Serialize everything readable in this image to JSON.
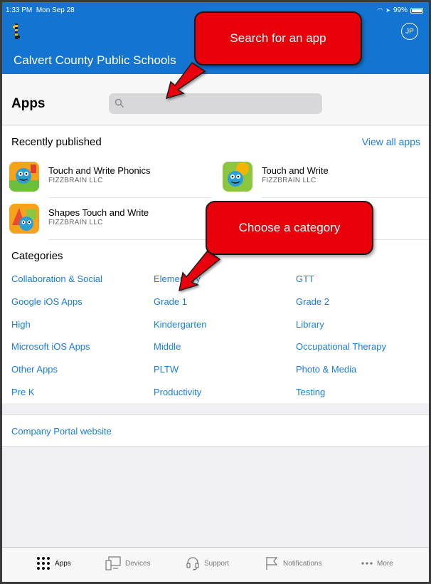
{
  "status_bar": {
    "time": "1:33 PM",
    "date": "Mon Sep 28",
    "battery": "99%"
  },
  "header": {
    "org_title": "Calvert County Public Schools",
    "avatar_initials": "JP"
  },
  "apps_bar": {
    "title": "Apps",
    "search_placeholder": ""
  },
  "recent": {
    "heading": "Recently published",
    "view_all": "View all apps",
    "items": [
      {
        "name": "Touch and Write Phonics",
        "publisher": "FIZZBRAIN LLC"
      },
      {
        "name": "Touch and Write",
        "publisher": "FIZZBRAIN LLC"
      },
      {
        "name": "Shapes Touch and Write",
        "publisher": "FIZZBRAIN LLC"
      }
    ]
  },
  "categories": {
    "heading": "Categories",
    "items": [
      "Collaboration & Social",
      "Elementary",
      "GTT",
      "Google iOS Apps",
      "Grade 1",
      "Grade 2",
      "High",
      "Kindergarten",
      "Library",
      "Microsoft iOS Apps",
      "Middle",
      "Occupational Therapy",
      "Other Apps",
      "PLTW",
      "Photo & Media",
      "Pre K",
      "Productivity",
      "Testing"
    ]
  },
  "portal": {
    "link": "Company Portal website"
  },
  "tabs": [
    {
      "label": "Apps",
      "icon": "grid-dots-icon",
      "active": true
    },
    {
      "label": "Devices",
      "icon": "devices-icon",
      "active": false
    },
    {
      "label": "Support",
      "icon": "headset-icon",
      "active": false
    },
    {
      "label": "Notifications",
      "icon": "flag-icon",
      "active": false
    },
    {
      "label": "More",
      "icon": "more-dots-icon",
      "active": false
    }
  ],
  "callouts": {
    "search": "Search for an app",
    "category": "Choose a category"
  },
  "colors": {
    "header_blue": "#1474d2",
    "link_blue": "#1a7ee0",
    "callout_red": "#e8000b"
  }
}
